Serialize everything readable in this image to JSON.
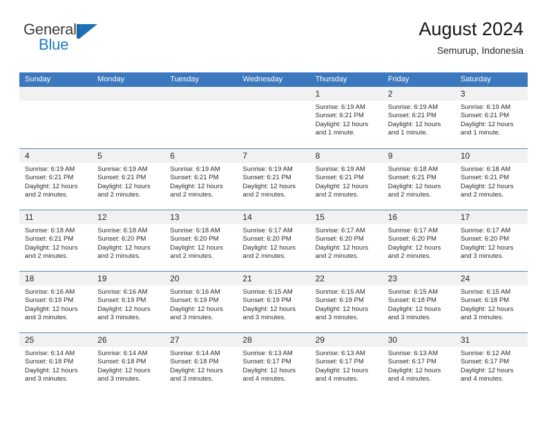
{
  "brand": {
    "name_top": "General",
    "name_bottom": "Blue",
    "accent_color": "#1a7bc4"
  },
  "header": {
    "title": "August 2024",
    "subtitle": "Semurup, Indonesia"
  },
  "theme": {
    "header_blue": "#3c78be",
    "daynum_band": "#f1f1f1",
    "row_divider": "#5b86b5"
  },
  "labels": {
    "sunrise_prefix": "Sunrise:",
    "sunset_prefix": "Sunset:",
    "daylight_prefix": "Daylight:"
  },
  "weekdays": [
    "Sunday",
    "Monday",
    "Tuesday",
    "Wednesday",
    "Thursday",
    "Friday",
    "Saturday"
  ],
  "weeks": [
    [
      {
        "day": "",
        "sunrise": "",
        "sunset": "",
        "daylight": ""
      },
      {
        "day": "",
        "sunrise": "",
        "sunset": "",
        "daylight": ""
      },
      {
        "day": "",
        "sunrise": "",
        "sunset": "",
        "daylight": ""
      },
      {
        "day": "",
        "sunrise": "",
        "sunset": "",
        "daylight": ""
      },
      {
        "day": "1",
        "sunrise": "Sunrise: 6:19 AM",
        "sunset": "Sunset: 6:21 PM",
        "daylight": "Daylight: 12 hours and 1 minute."
      },
      {
        "day": "2",
        "sunrise": "Sunrise: 6:19 AM",
        "sunset": "Sunset: 6:21 PM",
        "daylight": "Daylight: 12 hours and 1 minute."
      },
      {
        "day": "3",
        "sunrise": "Sunrise: 6:19 AM",
        "sunset": "Sunset: 6:21 PM",
        "daylight": "Daylight: 12 hours and 1 minute."
      }
    ],
    [
      {
        "day": "4",
        "sunrise": "Sunrise: 6:19 AM",
        "sunset": "Sunset: 6:21 PM",
        "daylight": "Daylight: 12 hours and 2 minutes."
      },
      {
        "day": "5",
        "sunrise": "Sunrise: 6:19 AM",
        "sunset": "Sunset: 6:21 PM",
        "daylight": "Daylight: 12 hours and 2 minutes."
      },
      {
        "day": "6",
        "sunrise": "Sunrise: 6:19 AM",
        "sunset": "Sunset: 6:21 PM",
        "daylight": "Daylight: 12 hours and 2 minutes."
      },
      {
        "day": "7",
        "sunrise": "Sunrise: 6:19 AM",
        "sunset": "Sunset: 6:21 PM",
        "daylight": "Daylight: 12 hours and 2 minutes."
      },
      {
        "day": "8",
        "sunrise": "Sunrise: 6:19 AM",
        "sunset": "Sunset: 6:21 PM",
        "daylight": "Daylight: 12 hours and 2 minutes."
      },
      {
        "day": "9",
        "sunrise": "Sunrise: 6:18 AM",
        "sunset": "Sunset: 6:21 PM",
        "daylight": "Daylight: 12 hours and 2 minutes."
      },
      {
        "day": "10",
        "sunrise": "Sunrise: 6:18 AM",
        "sunset": "Sunset: 6:21 PM",
        "daylight": "Daylight: 12 hours and 2 minutes."
      }
    ],
    [
      {
        "day": "11",
        "sunrise": "Sunrise: 6:18 AM",
        "sunset": "Sunset: 6:21 PM",
        "daylight": "Daylight: 12 hours and 2 minutes."
      },
      {
        "day": "12",
        "sunrise": "Sunrise: 6:18 AM",
        "sunset": "Sunset: 6:20 PM",
        "daylight": "Daylight: 12 hours and 2 minutes."
      },
      {
        "day": "13",
        "sunrise": "Sunrise: 6:18 AM",
        "sunset": "Sunset: 6:20 PM",
        "daylight": "Daylight: 12 hours and 2 minutes."
      },
      {
        "day": "14",
        "sunrise": "Sunrise: 6:17 AM",
        "sunset": "Sunset: 6:20 PM",
        "daylight": "Daylight: 12 hours and 2 minutes."
      },
      {
        "day": "15",
        "sunrise": "Sunrise: 6:17 AM",
        "sunset": "Sunset: 6:20 PM",
        "daylight": "Daylight: 12 hours and 2 minutes."
      },
      {
        "day": "16",
        "sunrise": "Sunrise: 6:17 AM",
        "sunset": "Sunset: 6:20 PM",
        "daylight": "Daylight: 12 hours and 2 minutes."
      },
      {
        "day": "17",
        "sunrise": "Sunrise: 6:17 AM",
        "sunset": "Sunset: 6:20 PM",
        "daylight": "Daylight: 12 hours and 3 minutes."
      }
    ],
    [
      {
        "day": "18",
        "sunrise": "Sunrise: 6:16 AM",
        "sunset": "Sunset: 6:19 PM",
        "daylight": "Daylight: 12 hours and 3 minutes."
      },
      {
        "day": "19",
        "sunrise": "Sunrise: 6:16 AM",
        "sunset": "Sunset: 6:19 PM",
        "daylight": "Daylight: 12 hours and 3 minutes."
      },
      {
        "day": "20",
        "sunrise": "Sunrise: 6:16 AM",
        "sunset": "Sunset: 6:19 PM",
        "daylight": "Daylight: 12 hours and 3 minutes."
      },
      {
        "day": "21",
        "sunrise": "Sunrise: 6:15 AM",
        "sunset": "Sunset: 6:19 PM",
        "daylight": "Daylight: 12 hours and 3 minutes."
      },
      {
        "day": "22",
        "sunrise": "Sunrise: 6:15 AM",
        "sunset": "Sunset: 6:19 PM",
        "daylight": "Daylight: 12 hours and 3 minutes."
      },
      {
        "day": "23",
        "sunrise": "Sunrise: 6:15 AM",
        "sunset": "Sunset: 6:18 PM",
        "daylight": "Daylight: 12 hours and 3 minutes."
      },
      {
        "day": "24",
        "sunrise": "Sunrise: 6:15 AM",
        "sunset": "Sunset: 6:18 PM",
        "daylight": "Daylight: 12 hours and 3 minutes."
      }
    ],
    [
      {
        "day": "25",
        "sunrise": "Sunrise: 6:14 AM",
        "sunset": "Sunset: 6:18 PM",
        "daylight": "Daylight: 12 hours and 3 minutes."
      },
      {
        "day": "26",
        "sunrise": "Sunrise: 6:14 AM",
        "sunset": "Sunset: 6:18 PM",
        "daylight": "Daylight: 12 hours and 3 minutes."
      },
      {
        "day": "27",
        "sunrise": "Sunrise: 6:14 AM",
        "sunset": "Sunset: 6:18 PM",
        "daylight": "Daylight: 12 hours and 3 minutes."
      },
      {
        "day": "28",
        "sunrise": "Sunrise: 6:13 AM",
        "sunset": "Sunset: 6:17 PM",
        "daylight": "Daylight: 12 hours and 4 minutes."
      },
      {
        "day": "29",
        "sunrise": "Sunrise: 6:13 AM",
        "sunset": "Sunset: 6:17 PM",
        "daylight": "Daylight: 12 hours and 4 minutes."
      },
      {
        "day": "30",
        "sunrise": "Sunrise: 6:13 AM",
        "sunset": "Sunset: 6:17 PM",
        "daylight": "Daylight: 12 hours and 4 minutes."
      },
      {
        "day": "31",
        "sunrise": "Sunrise: 6:12 AM",
        "sunset": "Sunset: 6:17 PM",
        "daylight": "Daylight: 12 hours and 4 minutes."
      }
    ]
  ]
}
